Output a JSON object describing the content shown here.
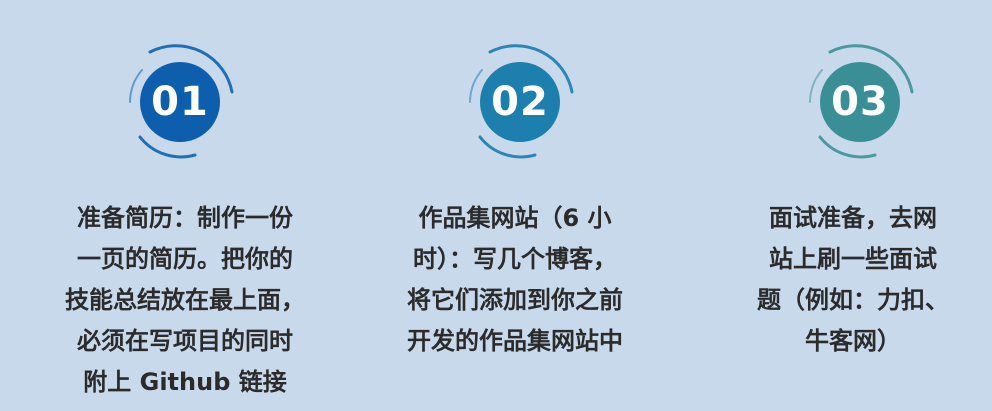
{
  "colors": {
    "background": "#c9d9ec",
    "text": "#2b2b2b",
    "step1_circle": "#0d5fae",
    "step2_circle": "#1d7fae",
    "step3_circle": "#3a8f97"
  },
  "steps": [
    {
      "number": "01",
      "lines": [
        "准备简历：制作一份",
        "一页的简历。把你的",
        "技能总结放在最上面，",
        "必须在写项目的同时",
        "附上 Github 链接"
      ]
    },
    {
      "number": "02",
      "lines": [
        "作品集网站（6 小",
        "时）：写几个博客，",
        "将它们添加到你之前",
        "开发的作品集网站中"
      ]
    },
    {
      "number": "03",
      "lines": [
        "面试准备，去网",
        "站上刷一些面试",
        "题（例如：力扣、",
        "牛客网）"
      ]
    }
  ]
}
